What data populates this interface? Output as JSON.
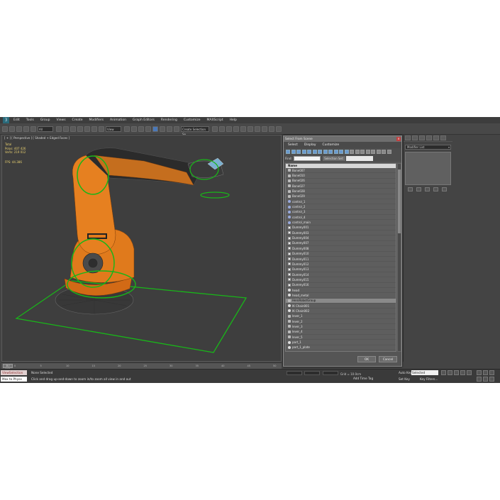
{
  "app": {
    "menu": [
      "Edit",
      "Tools",
      "Group",
      "Views",
      "Create",
      "Modifiers",
      "Animation",
      "Graph Editors",
      "Rendering",
      "Customize",
      "MAXScript",
      "Help"
    ],
    "toolbar": {
      "select_filter": "All",
      "coord_system": "View",
      "selection_set": "Create Selection Se"
    }
  },
  "viewport": {
    "label": "[ + ] [ Perspective ] [ Shaded + Edged Faces ]",
    "stats": {
      "header": "Total",
      "polys_label": "Polys:",
      "polys": "407 426",
      "verts_label": "Verts:",
      "verts": "219 012"
    },
    "fps_label": "FPS:",
    "fps": "44.386"
  },
  "timeline": {
    "slider": "0 / 100",
    "ticks": [
      "0",
      "5",
      "10",
      "15",
      "20",
      "25",
      "30",
      "35",
      "40",
      "45",
      "50"
    ]
  },
  "dialog": {
    "title": "Select From Scene",
    "menu": [
      "Select",
      "Display",
      "Customize"
    ],
    "find_label": "Find:",
    "find_value": "",
    "selection_set_label": "Selection Set:",
    "column": "Name",
    "rows": [
      "Bone007",
      "Bone010",
      "Bone026",
      "Bone027",
      "Bone028",
      "Bone029",
      "control_1",
      "control_2",
      "control_3",
      "control_4",
      "control_main",
      "Dummy001",
      "Dummy003",
      "Dummy004",
      "Dummy007",
      "Dummy008",
      "Dummy010",
      "Dummy011",
      "Dummy012",
      "Dummy013",
      "Dummy014",
      "Dummy015",
      "Dummy016",
      "head",
      "head_metal",
      "HeroRobotGroup",
      "IK Chain001",
      "IK Chain002",
      "lever_1",
      "lever_2",
      "lever_3",
      "lever_4",
      "lever_5",
      "part_1",
      "part_1_plate",
      "part_2"
    ],
    "selected_index": 25,
    "ok": "OK",
    "cancel": "Cancel"
  },
  "command_panel": {
    "modifier_list": "Modifier List"
  },
  "status": {
    "maxscript_top": "ViewSelection",
    "maxscript_bottom": "Max to Physx",
    "status": "None Selected",
    "prompt": "Click and drag up-and-down to zoom in/to zoom all view in and out",
    "grid": "Grid = 10.0cm",
    "add_time_tag": "Add Time Tag",
    "auto_key": "Auto Key",
    "auto_key_value": "Selected",
    "set_key": "Set Key",
    "key_filters": "Key Filters..."
  },
  "colors": {
    "accent": "#4a78b8",
    "robot": "#e07a1c",
    "selection": "#19b519",
    "close": "#c04040"
  }
}
